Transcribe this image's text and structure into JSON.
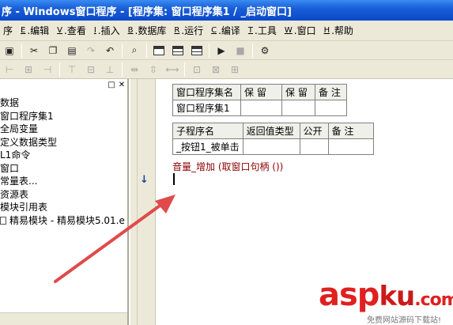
{
  "window": {
    "title": "序 - Windows窗口程序 - [程序集: 窗口程序集1 / _启动窗口]"
  },
  "menu": [
    {
      "key": "",
      "label": "序"
    },
    {
      "key": "E",
      "label": ".编辑"
    },
    {
      "key": "V",
      "label": ".查看"
    },
    {
      "key": "I",
      "label": ".插入"
    },
    {
      "key": "B",
      "label": ".数据库"
    },
    {
      "key": "R",
      "label": ".运行"
    },
    {
      "key": "C",
      "label": ".编译"
    },
    {
      "key": "T",
      "label": ".工具"
    },
    {
      "key": "W",
      "label": ".窗口"
    },
    {
      "key": "H",
      "label": ".帮助"
    }
  ],
  "tree": {
    "items": [
      "数据",
      "窗口程序集1",
      "全局变量",
      "定义数据类型",
      "L1命令",
      "窗口",
      "常量表...",
      "资源表",
      "模块引用表",
      "精易模块 - 精易模块5.01.e"
    ]
  },
  "assembly_table": {
    "headers": [
      "窗口程序集名",
      "保 留",
      "保 留",
      "备 注"
    ],
    "row": [
      "窗口程序集1",
      "",
      "",
      ""
    ]
  },
  "sub_table": {
    "headers": [
      "子程序名",
      "返回值类型",
      "公开",
      "备 注"
    ],
    "row": [
      "_按钮1_被单击",
      "",
      "",
      ""
    ]
  },
  "code": {
    "statement": "音量_增加 (取窗口句柄 ())"
  },
  "annotation": {
    "arrow_color": "#e04a4a"
  },
  "watermark": {
    "main_a": "asp",
    "main_ku": "ku",
    "main_com": ".com",
    "sub": "免费网站源码下载站!"
  }
}
